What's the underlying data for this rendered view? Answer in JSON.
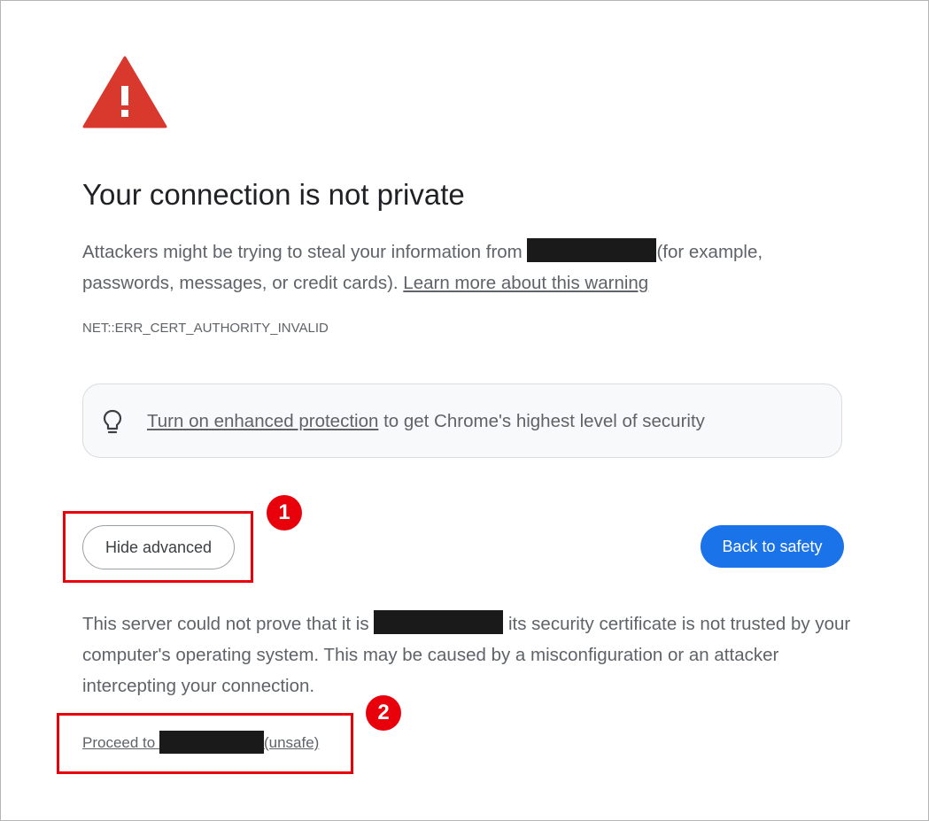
{
  "page": {
    "title": "Your connection is not private",
    "desc_before": "Attackers might be trying to steal your information from ",
    "desc_after": "(for example, passwords, messages, or credit cards). ",
    "learn_more_link": "Learn more about this warning",
    "error_code": "NET::ERR_CERT_AUTHORITY_INVALID"
  },
  "promo": {
    "icon": "lightbulb-icon",
    "link": "Turn on enhanced protection",
    "text": " to get Chrome's highest level of security"
  },
  "buttons": {
    "hide_advanced": "Hide advanced",
    "back_to_safety": "Back to safety"
  },
  "details": {
    "before": "This server could not prove that it is ",
    "after": " its security certificate is not trusted by your computer's operating system. This may be caused by a misconfiguration or an attacker intercepting your connection."
  },
  "proceed": {
    "before": "Proceed to ",
    "after": "(unsafe)"
  },
  "annotations": [
    {
      "number": "1"
    },
    {
      "number": "2"
    }
  ],
  "colors": {
    "warning_red": "#d9392c",
    "primary_blue": "#1a73e8",
    "annotation_red": "#e8000b",
    "redaction": "#1a1a1a"
  }
}
